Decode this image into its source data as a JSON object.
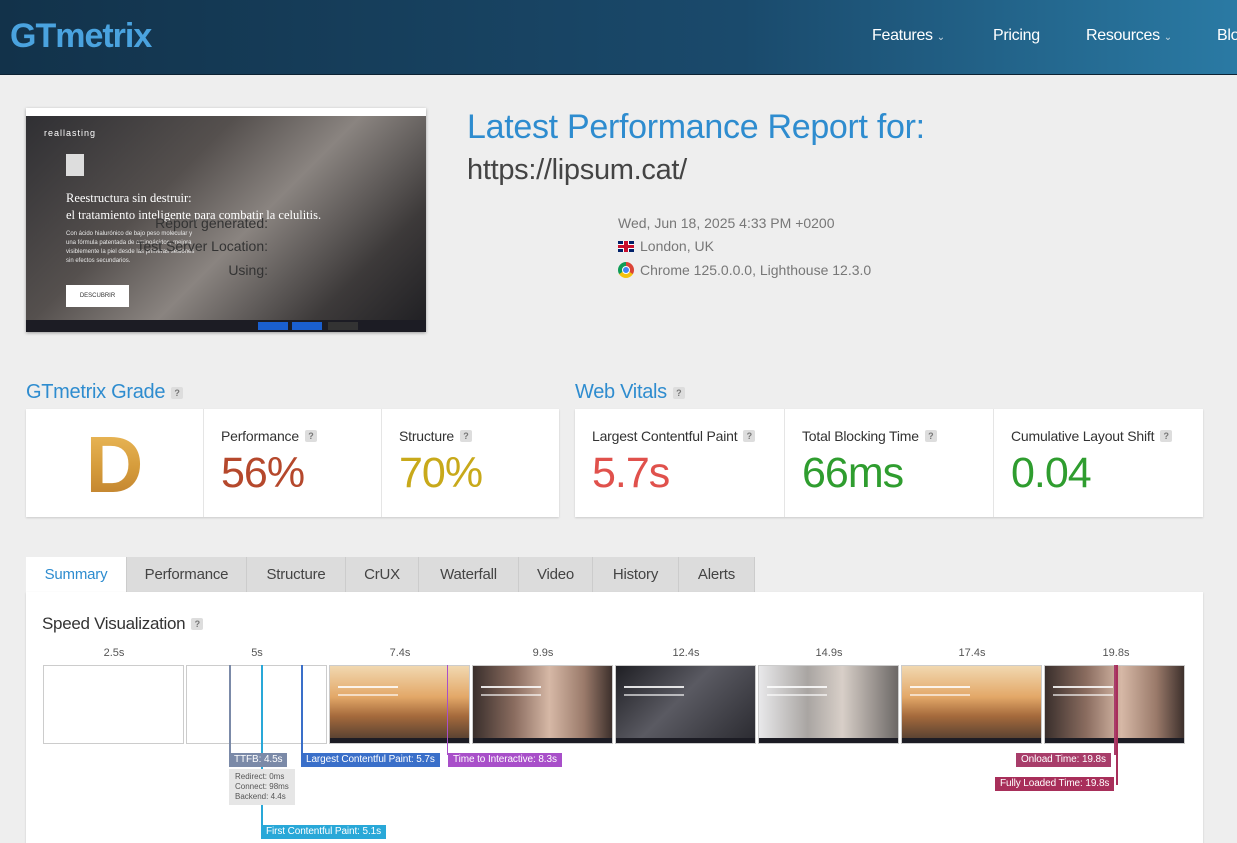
{
  "header": {
    "logo": {
      "part1": "GT",
      "part2": "metrix"
    },
    "nav": [
      {
        "label": "Features",
        "caret": true
      },
      {
        "label": "Pricing",
        "caret": false
      },
      {
        "label": "Resources",
        "caret": true
      },
      {
        "label": "Blo",
        "caret": false
      }
    ],
    "caret_glyph": "⌄"
  },
  "thumbnail": {
    "brand": "reallasting",
    "headline_1": "Reestructura sin destruir:",
    "headline_2": "el tratamiento inteligente para combatir la celulitis.",
    "body": "Con ácido hialurónico de bajo peso molecular y una fórmula patentada de aminoácidos, mejora visiblemente la piel desde las primeras sesiones sin efectos secundarios.",
    "cta": "DESCUBRIR"
  },
  "report": {
    "title": "Latest Performance Report for:",
    "url": "https://lipsum.cat/",
    "meta": [
      {
        "label": "Report generated:",
        "value": "Wed, Jun 18, 2025 4:33 PM +0200",
        "icon": ""
      },
      {
        "label": "Test Server Location:",
        "value": "London, UK",
        "icon": "uk-flag-icon"
      },
      {
        "label": "Using:",
        "value": "Chrome 125.0.0.0, Lighthouse 12.3.0",
        "icon": "chrome-icon"
      }
    ]
  },
  "grade": {
    "title": "GTmetrix Grade",
    "letter": "D",
    "performance_label": "Performance",
    "performance_value": "56%",
    "structure_label": "Structure",
    "structure_value": "70%"
  },
  "vitals": {
    "title": "Web Vitals",
    "lcp_label": "Largest Contentful Paint",
    "lcp_value": "5.7s",
    "tbt_label": "Total Blocking Time",
    "tbt_value": "66ms",
    "cls_label": "Cumulative Layout Shift",
    "cls_value": "0.04"
  },
  "help_glyph": "?",
  "tabs": [
    "Summary",
    "Performance",
    "Structure",
    "CrUX",
    "Waterfall",
    "Video",
    "History",
    "Alerts"
  ],
  "active_tab": "Summary",
  "speed": {
    "title": "Speed Visualization",
    "ticks": [
      "2.5s",
      "5s",
      "7.4s",
      "9.9s",
      "12.4s",
      "14.9s",
      "17.4s",
      "19.8s"
    ],
    "frames": [
      "blank",
      "blank",
      "sunset",
      "group",
      "dark",
      "light",
      "sunset",
      "group"
    ],
    "markers": {
      "ttfb": "TTFB: 4.5s",
      "ttfb_redirect": "Redirect: 0ms",
      "ttfb_connect": "Connect: 98ms",
      "ttfb_backend": "Backend: 4.4s",
      "lcp": "Largest Contentful Paint: 5.7s",
      "tti": "Time to Interactive: 8.3s",
      "fcp": "First Contentful Paint: 5.1s",
      "onload": "Onload Time: 19.8s",
      "fully_loaded": "Fully Loaded Time: 19.8s"
    }
  },
  "colors": {
    "accent": "#2e8ccf",
    "performance": "#b5482c",
    "structure": "#c8a91a",
    "lcp": "#e0514c",
    "good": "#2f9d2f",
    "ttfb": "#7b8aa8",
    "fcp": "#29a8d8",
    "lcp_marker": "#3a6fc9",
    "tti": "#a84fc9",
    "onload": "#a83d6a",
    "fully_loaded": "#a82f5a"
  }
}
